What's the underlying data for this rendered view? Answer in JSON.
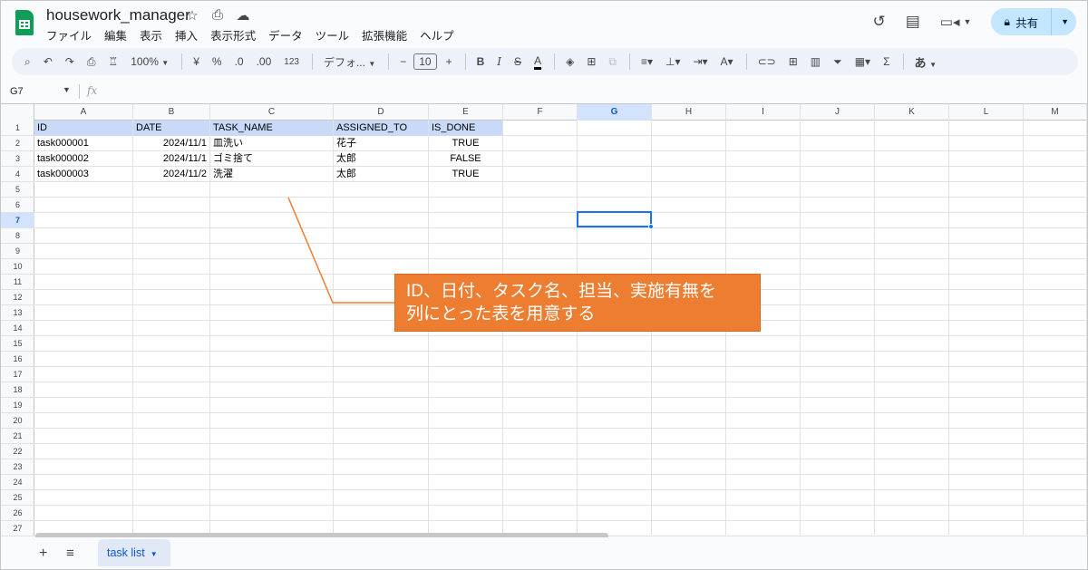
{
  "app": {
    "doc_title": "housework_manager",
    "menu": [
      "ファイル",
      "編集",
      "表示",
      "挿入",
      "表示形式",
      "データ",
      "ツール",
      "拡張機能",
      "ヘルプ"
    ],
    "share_label": "共有"
  },
  "toolbar": {
    "zoom": "100%",
    "currency": "¥",
    "percent": "%",
    "dec_decrease": ".0",
    "dec_increase": ".00",
    "number_format": "123",
    "font": "デフォ...",
    "font_size": "10",
    "bold": "B",
    "italic": "I",
    "strike": "S",
    "text_color": "A",
    "sum": "Σ",
    "input_mode": "あ"
  },
  "formula_bar": {
    "cell_ref": "G7",
    "fx_label": "fx"
  },
  "grid": {
    "columns": [
      "A",
      "B",
      "C",
      "D",
      "E",
      "F",
      "G",
      "H",
      "I",
      "J",
      "K",
      "L",
      "M"
    ],
    "selected_column": "G",
    "rows": [
      "1",
      "2",
      "3",
      "4",
      "5",
      "6",
      "7",
      "8",
      "9",
      "10",
      "11",
      "12",
      "13",
      "14",
      "15",
      "16",
      "17",
      "18",
      "19",
      "20",
      "21",
      "22",
      "23",
      "24",
      "25",
      "26",
      "27"
    ],
    "selected_row": "7",
    "header": [
      "ID",
      "DATE",
      "TASK_NAME",
      "ASSIGNED_TO",
      "IS_DONE"
    ],
    "data": [
      [
        "task000001",
        "2024/11/1",
        "皿洗い",
        "花子",
        "TRUE"
      ],
      [
        "task000002",
        "2024/11/1",
        "ゴミ捨て",
        "太郎",
        "FALSE"
      ],
      [
        "task000003",
        "2024/11/2",
        "洗濯",
        "太郎",
        "TRUE"
      ]
    ]
  },
  "annotation": {
    "line1": "ID、日付、タスク名、担当、実施有無を",
    "line2": "列にとった表を用意する"
  },
  "sheets": {
    "active_tab": "task list"
  }
}
